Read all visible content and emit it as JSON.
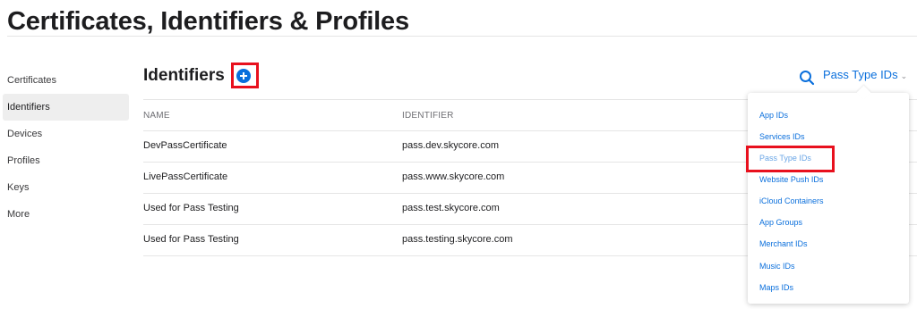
{
  "page": {
    "title": "Certificates, Identifiers & Profiles"
  },
  "sidebar": {
    "items": [
      {
        "label": "Certificates",
        "active": false
      },
      {
        "label": "Identifiers",
        "active": true
      },
      {
        "label": "Devices",
        "active": false
      },
      {
        "label": "Profiles",
        "active": false
      },
      {
        "label": "Keys",
        "active": false
      },
      {
        "label": "More",
        "active": false
      }
    ]
  },
  "main": {
    "section_title": "Identifiers",
    "add_icon": "plus-circle-icon",
    "search_icon": "search-icon",
    "filter": {
      "selected": "Pass Type IDs",
      "chevron": "⌄"
    }
  },
  "table": {
    "headers": [
      "NAME",
      "IDENTIFIER"
    ],
    "rows": [
      {
        "name": "DevPassCertificate",
        "identifier": "pass.dev.skycore.com"
      },
      {
        "name": "LivePassCertificate",
        "identifier": "pass.www.skycore.com"
      },
      {
        "name": "Used for Pass Testing",
        "identifier": "pass.test.skycore.com"
      },
      {
        "name": "Used for Pass Testing",
        "identifier": "pass.testing.skycore.com"
      }
    ]
  },
  "dropdown": {
    "options": [
      "App IDs",
      "Services IDs",
      "Pass Type IDs",
      "Website Push IDs",
      "iCloud Containers",
      "App Groups",
      "Merchant IDs",
      "Music IDs",
      "Maps IDs"
    ],
    "selected": "Pass Type IDs"
  },
  "colors": {
    "accent": "#0a6fdc",
    "highlight_border": "#e8101d",
    "active_sidebar_bg": "#eeeeee"
  }
}
